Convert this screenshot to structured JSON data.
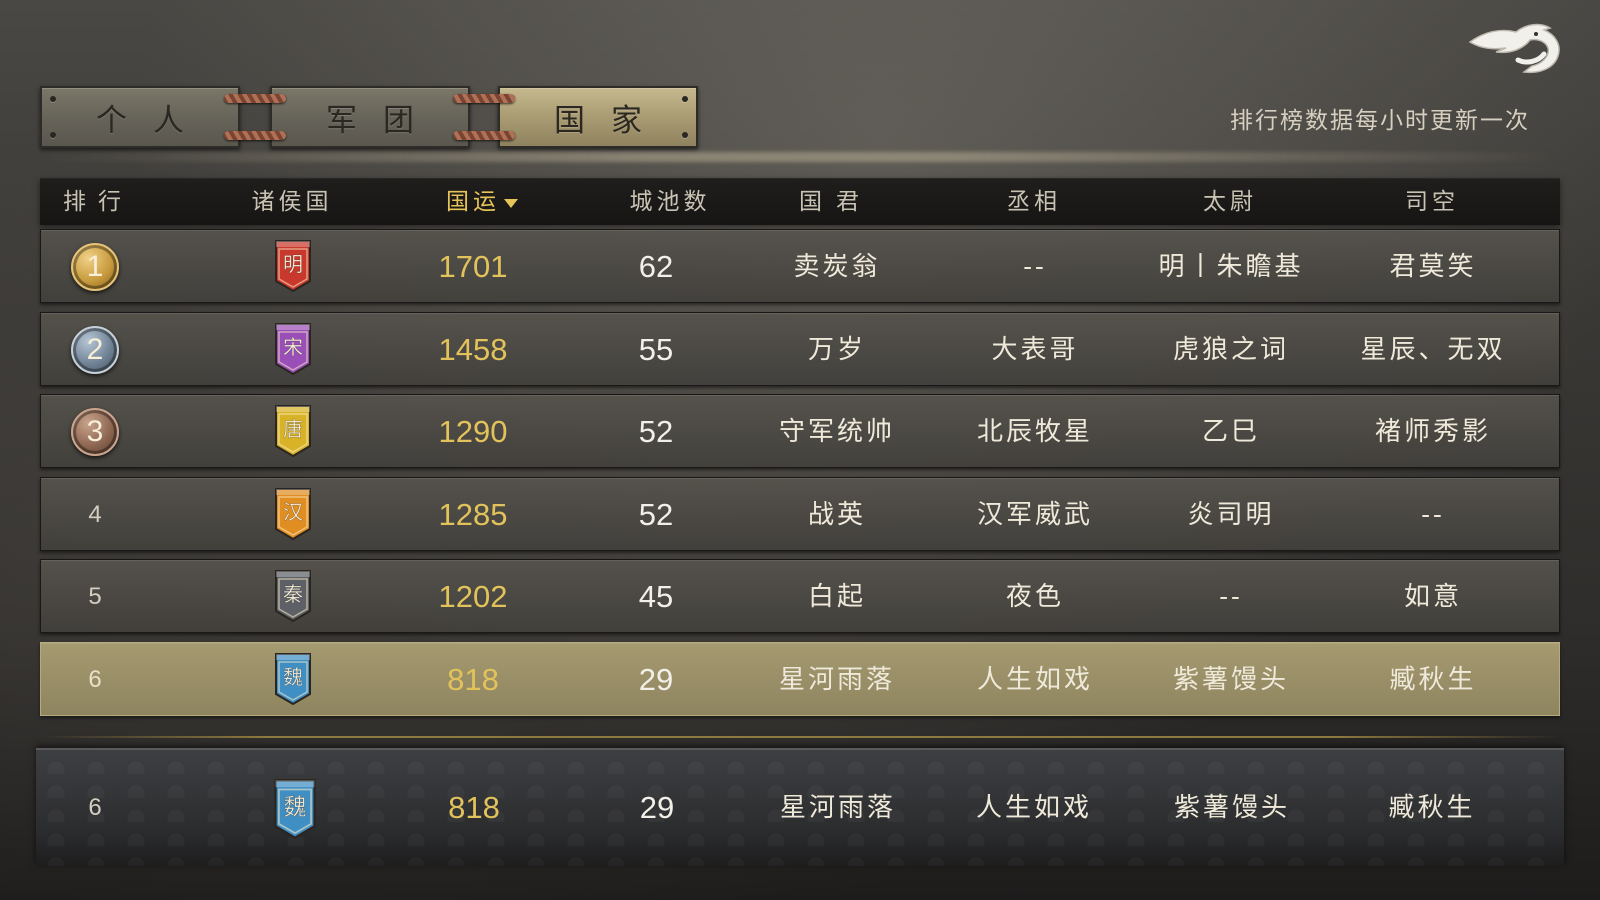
{
  "tabs": [
    {
      "label": "个人",
      "active": false
    },
    {
      "label": "军团",
      "active": false
    },
    {
      "label": "国家",
      "active": true
    }
  ],
  "notice": "排行榜数据每小时更新一次",
  "columns": [
    "排行",
    "诸侯国",
    "国运",
    "城池数",
    "国君",
    "丞相",
    "太尉",
    "司空"
  ],
  "sorted_column": "国运",
  "rows": [
    {
      "rank": "1",
      "medal": "gold",
      "nation": "明",
      "flag_color": "#c8382d",
      "luck": "1701",
      "cities": "62",
      "ruler": "卖炭翁",
      "chancellor": "--",
      "marshal": "明丨朱瞻基",
      "minister": "君莫笑"
    },
    {
      "rank": "2",
      "medal": "silver",
      "nation": "宋",
      "flag_color": "#9a4fb8",
      "luck": "1458",
      "cities": "55",
      "ruler": "万岁",
      "chancellor": "大表哥",
      "marshal": "虎狼之词",
      "minister": "星辰、无双"
    },
    {
      "rank": "3",
      "medal": "bronze",
      "nation": "唐",
      "flag_color": "#d8b227",
      "luck": "1290",
      "cities": "52",
      "ruler": "守军统帅",
      "chancellor": "北辰牧星",
      "marshal": "乙巳",
      "minister": "褚师秀影"
    },
    {
      "rank": "4",
      "medal": "",
      "nation": "汉",
      "flag_color": "#e08d22",
      "luck": "1285",
      "cities": "52",
      "ruler": "战英",
      "chancellor": "汉军威武",
      "marshal": "炎司明",
      "minister": "--"
    },
    {
      "rank": "5",
      "medal": "",
      "nation": "秦",
      "flag_color": "#5d6167",
      "luck": "1202",
      "cities": "45",
      "ruler": "白起",
      "chancellor": "夜色",
      "marshal": "--",
      "minister": "如意"
    },
    {
      "rank": "6",
      "medal": "",
      "nation": "魏",
      "flag_color": "#3f8fc4",
      "luck": "818",
      "cities": "29",
      "ruler": "星河雨落",
      "chancellor": "人生如戏",
      "marshal": "紫薯馒头",
      "minister": "臧秋生",
      "highlight": true
    }
  ],
  "self_row": {
    "rank": "6",
    "nation": "魏",
    "flag_color": "#3f8fc4",
    "luck": "818",
    "cities": "29",
    "ruler": "星河雨落",
    "chancellor": "人生如戏",
    "marshal": "紫薯馒头",
    "minister": "臧秋生"
  },
  "icons": {
    "back": "dragon-back-icon"
  }
}
